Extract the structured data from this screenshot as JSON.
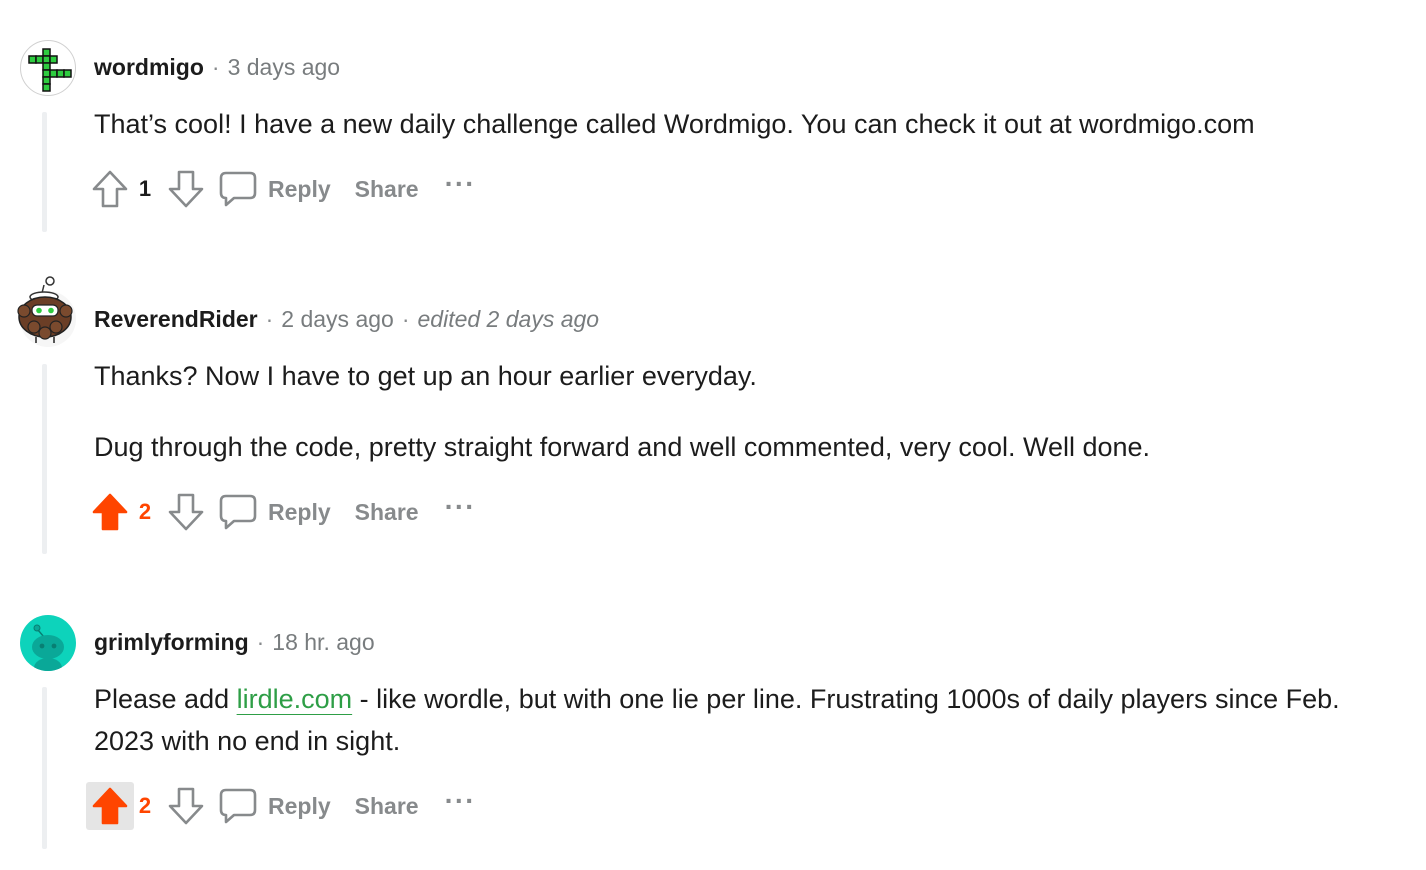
{
  "comments": [
    {
      "author": "wordmigo",
      "time": "3 days ago",
      "edited": "",
      "paragraphs": [
        "That’s cool! I have a new daily challenge called Wordmigo. You can check it out at wordmigo.com"
      ],
      "score": "1",
      "upvoted": false,
      "avatar_icon": "crossword-grid-icon"
    },
    {
      "author": "ReverendRider",
      "time": "2 days ago",
      "edited": "edited 2 days ago",
      "paragraphs": [
        "Thanks? Now I have to get up an hour earlier everyday.",
        "Dug through the code, pretty straight forward and well commented, very cool. Well done."
      ],
      "score": "2",
      "upvoted": true,
      "avatar_icon": "bearded-snoo-icon"
    },
    {
      "author": "grimlyforming",
      "time": "18 hr. ago",
      "edited": "",
      "body_before_link": "Please add ",
      "link_text": "lirdle.com",
      "body_after_link": " - like wordle, but with one lie per line. Frustrating 1000s of daily players since Feb. 2023 with no end in sight.",
      "score": "2",
      "upvoted": true,
      "avatar_icon": "teal-snoo-icon"
    }
  ],
  "actions": {
    "reply_label": "Reply",
    "share_label": "Share",
    "more_label": "···"
  },
  "colors": {
    "upvote_active": "#ff4500",
    "muted": "#878a8c",
    "link": "#2e9e46",
    "thread_line": "#edeff1",
    "teal_avatar": "#0dd3bb"
  }
}
